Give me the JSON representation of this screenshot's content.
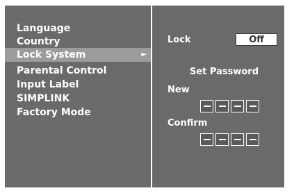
{
  "menu": {
    "items": [
      {
        "label": "Language"
      },
      {
        "label": "Country"
      },
      {
        "label": "Lock System",
        "selected": true,
        "arrow": "►"
      },
      {
        "label": "Parental Control"
      },
      {
        "label": "Input Label"
      },
      {
        "label": "SIMPLINK"
      },
      {
        "label": "Factory Mode"
      }
    ]
  },
  "panel": {
    "lock_label": "Lock",
    "lock_value": "Off",
    "set_password_title": "Set Password",
    "new_label": "New",
    "confirm_label": "Confirm",
    "new_digits": [
      "-",
      "-",
      "-",
      "-"
    ],
    "confirm_digits": [
      "-",
      "-",
      "-",
      "-"
    ]
  },
  "colors": {
    "background": "#6a6a6a",
    "selected_row": "#9b9b9b",
    "text": "#ffffff"
  }
}
